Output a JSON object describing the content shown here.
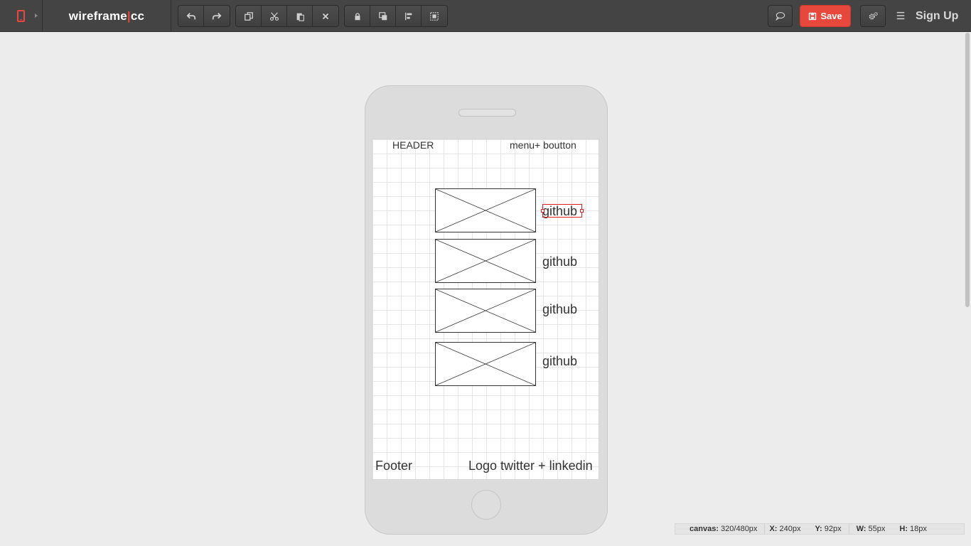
{
  "app": {
    "logo_left": "wireframe",
    "logo_bar": "|",
    "logo_right": "cc",
    "device_icon": "phone-icon",
    "save_label": "Save",
    "signup_label": "Sign Up",
    "accent_color": "#e8473b"
  },
  "toolbar": {
    "history": [
      "undo-icon",
      "redo-icon"
    ],
    "edit": [
      "duplicate-icon",
      "cut-icon",
      "paste-icon",
      "delete-icon"
    ],
    "arrange": [
      "lock-icon",
      "layer-icon",
      "align-icon",
      "group-icon"
    ],
    "right": [
      "comment-icon",
      "save-icon",
      "settings-icon",
      "menu-icon"
    ]
  },
  "wireframe": {
    "header_left": "HEADER",
    "header_right": "menu+ boutton",
    "items": [
      {
        "label": "github"
      },
      {
        "label": "github"
      },
      {
        "label": "github"
      },
      {
        "label": "github"
      }
    ],
    "footer_left": "Footer",
    "footer_right": "Logo twitter + linkedin"
  },
  "status": {
    "canvas_label": "canvas:",
    "canvas_value": "320/480px",
    "x_label": "X:",
    "x_value": "240px",
    "y_label": "Y:",
    "y_value": "92px",
    "w_label": "W:",
    "w_value": "55px",
    "h_label": "H:",
    "h_value": "18px"
  }
}
